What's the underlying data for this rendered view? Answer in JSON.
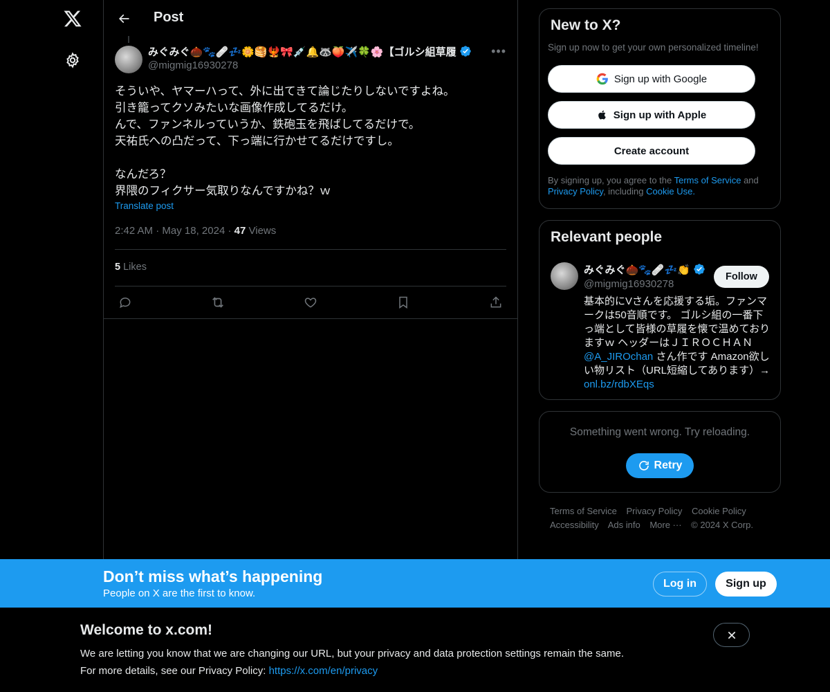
{
  "nav": {
    "logo_icon": "x-logo-icon",
    "settings_icon": "gear-icon"
  },
  "header": {
    "title": "Post"
  },
  "post": {
    "author_name": "みぐみぐ🌰🐾🩹💤🌼🥞🐦‍🔥🎀💉🔔🦝🍑✈️🍀🌸【ゴルシ組草履",
    "author_handle": "@migmig16930278",
    "text_lines": [
      "そういや、ヤマーハって、外に出てきて論じたりしないですよね。",
      "引き籠ってクソみたいな画像作成してるだけ。",
      "んで、ファンネルっていうか、鉄砲玉を飛ばしてるだけで。",
      "天祐氏への凸だって、下っ端に行かせてるだけですし。",
      "",
      "なんだろ？",
      "界隈のフィクサー気取りなんですかね？ｗ"
    ],
    "translate_label": "Translate post",
    "time": "2:42 AM",
    "date": "May 18, 2024",
    "views_count": "47",
    "views_label": "Views",
    "likes_count": "5",
    "likes_label": "Likes"
  },
  "signup_card": {
    "title": "New to X?",
    "subtitle": "Sign up now to get your own personalized timeline!",
    "google_label": "Sign up with Google",
    "apple_label": "Sign up with Apple",
    "create_label": "Create account",
    "legal_prefix": "By signing up, you agree to the",
    "terms_label": "Terms of Service",
    "and_label": "and",
    "privacy_label": "Privacy Policy",
    "including_label": ", including",
    "cookie_label": "Cookie Use."
  },
  "relevant_people": {
    "title": "Relevant people",
    "name": "みぐみぐ🌰🐾🩹💤👏",
    "handle": "@migmig16930278",
    "follow_label": "Follow",
    "bio_part1": "基本的にVさんを応援する垢。ファンマークは50音順です。 ゴルシ組の一番下っ端として皆様の草履を懐で温めておりますｗ ヘッダーはＪＩＲＯＣＨＡＮ ",
    "bio_mention": "@A_JIROchan",
    "bio_part2": " さん作です Amazon欲しい物リスト（URL短縮してあります）→ ",
    "bio_link": "onl.bz/rdbXEqs"
  },
  "error_card": {
    "message": "Something went wrong. Try reloading.",
    "retry_label": "Retry"
  },
  "footer": {
    "links": [
      "Terms of Service",
      "Privacy Policy",
      "Cookie Policy",
      "Accessibility",
      "Ads info",
      "More ···",
      "© 2024 X Corp."
    ]
  },
  "bottom_bar": {
    "title": "Don’t miss what’s happening",
    "subtitle": "People on X are the first to know.",
    "login_label": "Log in",
    "signup_label": "Sign up"
  },
  "notice": {
    "title": "Welcome to x.com!",
    "line1": "We are letting you know that we are changing our URL, but your privacy and data protection settings remain the same.",
    "line2_prefix": "For more details, see our Privacy Policy: ",
    "line2_link": "https://x.com/en/privacy"
  },
  "colors": {
    "accent": "#1d9bf0",
    "background": "#000000",
    "text": "#e7e9ea",
    "muted": "#71767b",
    "border": "#2f3336"
  }
}
